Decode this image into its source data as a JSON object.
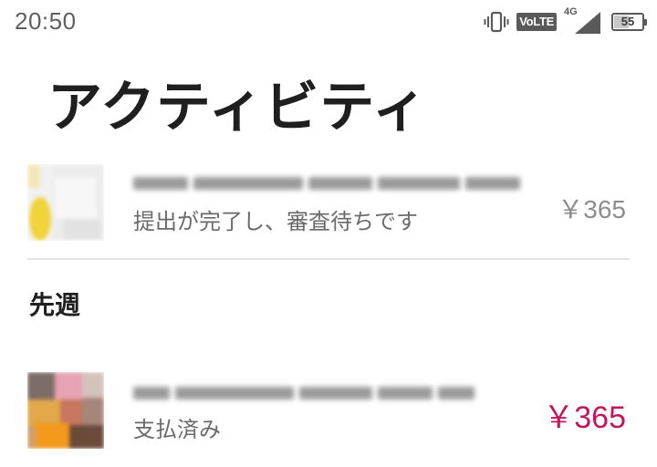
{
  "status_bar": {
    "time": "20:50",
    "volte": "VoLTE",
    "network": "4G",
    "battery": 55,
    "battery_label": "55"
  },
  "title": "アクティビティ",
  "items": [
    {
      "subtitle": "提出が完了し、審査待ちです",
      "price": "￥365",
      "price_color": "#8d8d8d"
    },
    {
      "subtitle": "支払済み",
      "price": "￥365",
      "price_color": "#c2185b"
    }
  ],
  "sections": [
    {
      "label": "先週"
    }
  ],
  "colors": {
    "accent": "#c2185b",
    "title_text": "#1f1f1f",
    "secondary_text": "#6a6a6a",
    "divider": "#e3e3e3"
  }
}
